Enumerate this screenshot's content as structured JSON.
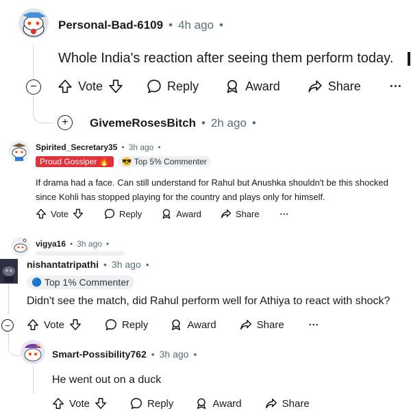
{
  "comment1": {
    "username": "Personal-Bad-6109",
    "time": "4h ago",
    "body": "Whole India's reaction after seeing them perform today.",
    "actions": {
      "vote": "Vote",
      "reply": "Reply",
      "award": "Award",
      "share": "Share",
      "more": "···"
    }
  },
  "collapsed_reply": {
    "username": "GivemeRosesBitch",
    "time": "2h ago"
  },
  "comment2": {
    "username": "Spirited_Secretary35",
    "time": "3h ago",
    "badge1": "Proud Gossiper 🔥",
    "badge2": "😎 Top 5% Commenter",
    "body_line1": "If drama had a face. Can still understand for Rahul but Anushka shouldn't be this shocked",
    "body_line2": "since Kohli has stopped playing for the country and plays only for himself.",
    "actions": {
      "vote": "Vote",
      "reply": "Reply",
      "award": "Award",
      "share": "Share",
      "more": "···"
    }
  },
  "comment3": {
    "username": "vigya16",
    "time": "3h ago"
  },
  "comment4": {
    "username": "nishantatripathi",
    "time": "3h ago",
    "badge": "Top 1% Commenter",
    "body": "Didn't see the match, did Rahul perform well for Athiya to react with shock?",
    "actions": {
      "vote": "Vote",
      "reply": "Reply",
      "award": "Award",
      "share": "Share",
      "more": "···"
    }
  },
  "comment5": {
    "username": "Smart-Possibility762",
    "time": "3h ago",
    "body": "He went out on a duck",
    "actions": {
      "vote": "Vote",
      "reply": "Reply",
      "award": "Award",
      "share": "Share"
    }
  },
  "colors": {
    "text": "#1a1a1b",
    "muted": "#576f76",
    "line": "#d6d9dc",
    "badge_red": "#e0323a",
    "badge_gray": "#eef1f3"
  },
  "icons": [
    "upvote-icon",
    "downvote-icon",
    "reply-bubble-icon",
    "award-icon",
    "share-icon",
    "collapse-icon",
    "expand-icon"
  ]
}
